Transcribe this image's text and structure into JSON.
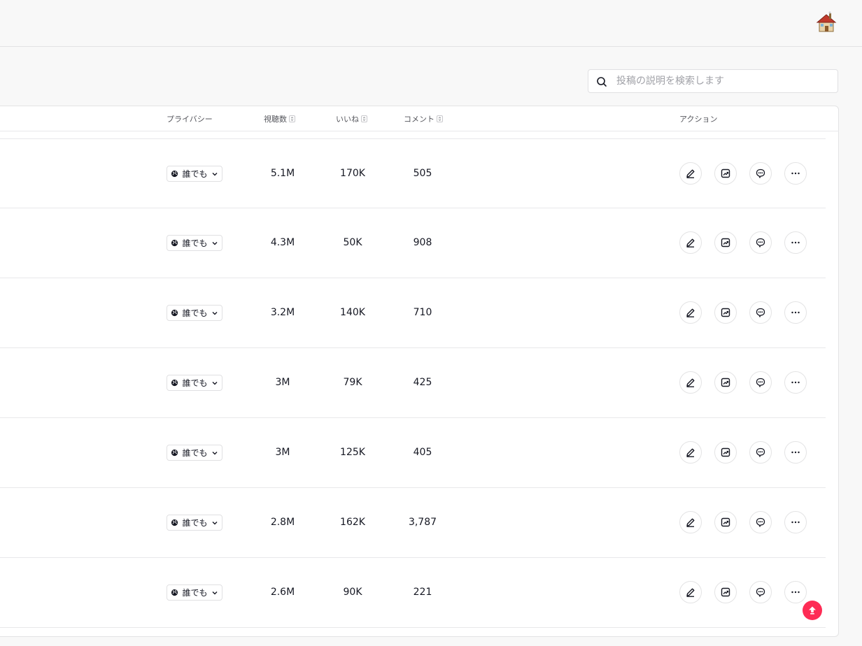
{
  "header": {
    "avatar_icon": "house-avatar-icon"
  },
  "search": {
    "placeholder": "投稿の説明を検索します",
    "value": ""
  },
  "table": {
    "columns": {
      "privacy": "プライバシー",
      "views": "視聴数",
      "likes": "いいね",
      "comments": "コメント",
      "actions": "アクション"
    },
    "rows": [
      {
        "privacy": "誰でも",
        "views": "5.1M",
        "likes": "170K",
        "comments": "505"
      },
      {
        "privacy": "誰でも",
        "views": "4.3M",
        "likes": "50K",
        "comments": "908"
      },
      {
        "privacy": "誰でも",
        "views": "3.2M",
        "likes": "140K",
        "comments": "710"
      },
      {
        "privacy": "誰でも",
        "views": "3M",
        "likes": "79K",
        "comments": "425"
      },
      {
        "privacy": "誰でも",
        "views": "3M",
        "likes": "125K",
        "comments": "405"
      },
      {
        "privacy": "誰でも",
        "views": "2.8M",
        "likes": "162K",
        "comments": "3,787"
      },
      {
        "privacy": "誰でも",
        "views": "2.6M",
        "likes": "90K",
        "comments": "221"
      }
    ],
    "action_icons": [
      "edit-icon",
      "analytics-icon",
      "comments-icon",
      "more-icon"
    ]
  },
  "colors": {
    "accent": "#fe2c55",
    "border": "#e3e3e4",
    "text": "#161823"
  }
}
